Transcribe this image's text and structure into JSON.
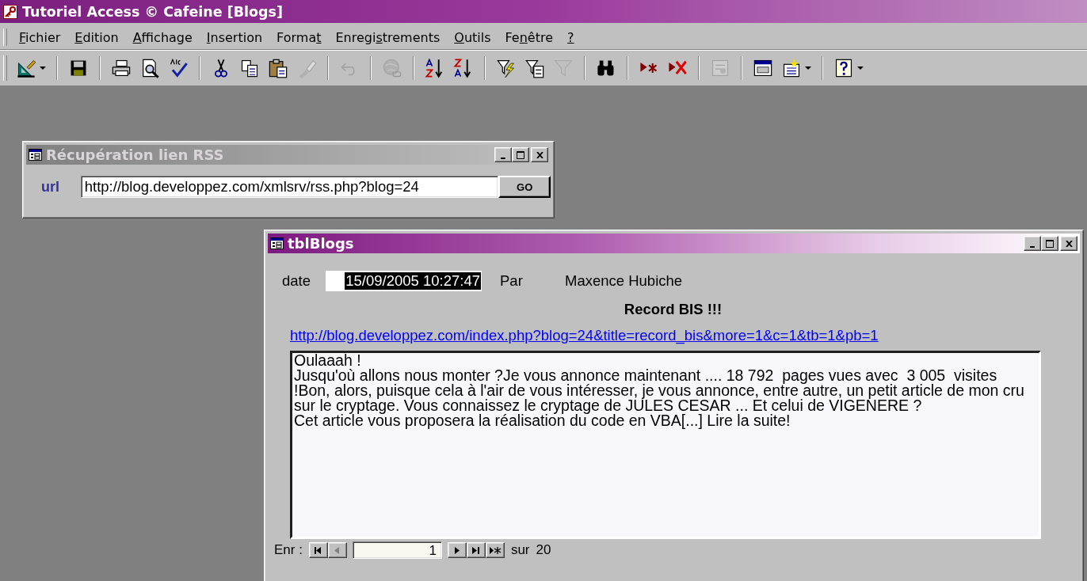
{
  "window": {
    "title": "Tutoriel Access © Cafeine [Blogs]"
  },
  "menu": [
    {
      "key": "F",
      "after": "ichier"
    },
    {
      "key": "E",
      "after": "dition"
    },
    {
      "key": "A",
      "after": "ffichage"
    },
    {
      "key": "I",
      "after": "nsertion"
    },
    {
      "before": "Forma",
      "key": "t"
    },
    {
      "before": "Enregi",
      "key": "s",
      "after": "trements"
    },
    {
      "key": "O",
      "after": "utils"
    },
    {
      "before": "Fe",
      "key": "n",
      "after": "être"
    },
    {
      "key": "?"
    }
  ],
  "toolbar": [
    [
      {
        "kind": "design",
        "disabled": false,
        "dropdown": true
      }
    ],
    [
      {
        "kind": "save",
        "disabled": false
      }
    ],
    [
      {
        "kind": "print",
        "disabled": false
      },
      {
        "kind": "preview",
        "disabled": false
      },
      {
        "kind": "spelling",
        "disabled": false
      }
    ],
    [
      {
        "kind": "cut",
        "disabled": false
      },
      {
        "kind": "copy",
        "disabled": false
      },
      {
        "kind": "paste",
        "disabled": false
      },
      {
        "kind": "painter",
        "disabled": true
      }
    ],
    [
      {
        "kind": "undo",
        "disabled": true
      }
    ],
    [
      {
        "kind": "hyperlink",
        "disabled": true
      }
    ],
    [
      {
        "kind": "sort_asc",
        "disabled": false
      },
      {
        "kind": "sort_desc",
        "disabled": false
      }
    ],
    [
      {
        "kind": "filter_selection",
        "disabled": false
      },
      {
        "kind": "filter_form",
        "disabled": false
      },
      {
        "kind": "filter",
        "disabled": true
      }
    ],
    [
      {
        "kind": "find",
        "disabled": false
      }
    ],
    [
      {
        "kind": "new_record",
        "disabled": false
      },
      {
        "kind": "delete_record",
        "disabled": false
      }
    ],
    [
      {
        "kind": "properties",
        "disabled": true
      }
    ],
    [
      {
        "kind": "database",
        "disabled": false
      },
      {
        "kind": "new_object",
        "disabled": false,
        "dropdown": true
      }
    ],
    [
      {
        "kind": "help",
        "disabled": false,
        "dropdown": true
      }
    ]
  ],
  "rss_window": {
    "title": "Récupération lien RSS",
    "active": false,
    "url_label": "url",
    "url_value": "http://blog.developpez.com/xmlsrv/rss.php?blog=24",
    "go_button": "GO"
  },
  "blog_window": {
    "title": "tblBlogs",
    "active": true,
    "date_label": "date",
    "date_value": "15/09/2005 10:27:47",
    "date_text_selected": true,
    "author_label": "Par",
    "author": "Maxence Hubiche",
    "post_title": "Record BIS !!!",
    "link": "http://blog.developpez.com/index.php?blog=24&title=record_bis&more=1&c=1&tb=1&pb=1",
    "content_lines": [
      "Oulaaah !",
      "Jusqu'où allons nous monter ?Je vous annonce maintenant .... 18 792  pages vues avec  3 005  visites",
      "!Bon, alors, puisque cela à l'air de vous intéresser, je vous annonce, entre autre, un petit article de mon cru",
      "sur le cryptage. Vous connaissez le cryptage de JULES CESAR ... Et celui de VIGENERE ?",
      "Cet article vous proposera la réalisation du code en VBA[...] Lire la suite!"
    ],
    "navigator": {
      "label": "Enr :",
      "record": "1",
      "of_label": "sur",
      "total": "20",
      "buttons": [
        {
          "kind": "first",
          "disabled": false
        },
        {
          "kind": "prev",
          "disabled": true
        },
        {
          "kind": "next",
          "disabled": false
        },
        {
          "kind": "last",
          "disabled": false
        },
        {
          "kind": "new",
          "disabled": false
        }
      ]
    }
  }
}
